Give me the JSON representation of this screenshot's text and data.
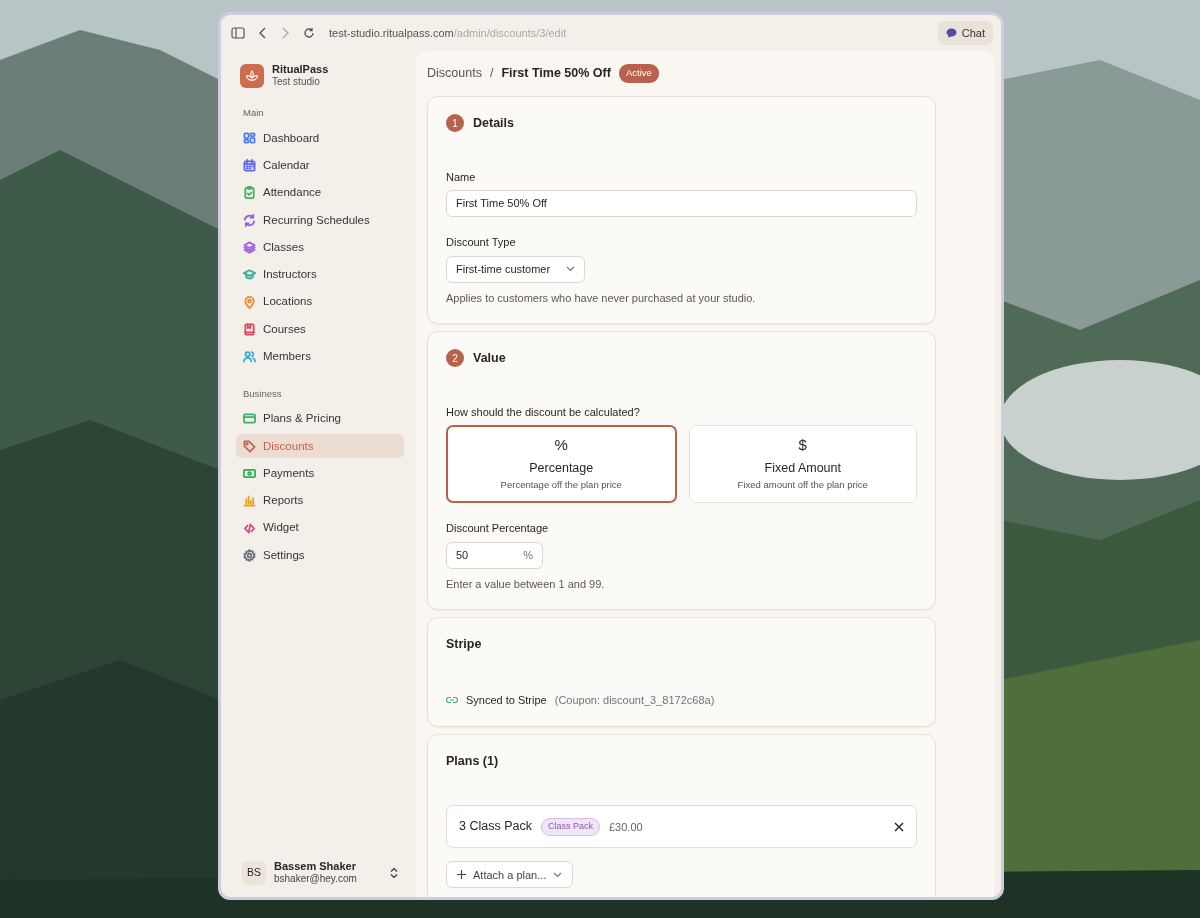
{
  "browser": {
    "url_host": "test-studio.ritualpass.com",
    "url_path": "/admin/discounts/3/edit",
    "chat_button": "Chat"
  },
  "sidebar": {
    "brand": {
      "name": "RitualPass",
      "subtitle": "Test studio"
    },
    "sections": [
      {
        "title": "Main",
        "items": [
          {
            "label": "Dashboard",
            "selected": false,
            "color": "#4f7be8"
          },
          {
            "label": "Calendar",
            "selected": false,
            "color": "#6366f1"
          },
          {
            "label": "Attendance",
            "selected": false,
            "color": "#3fb25a"
          },
          {
            "label": "Recurring Schedules",
            "selected": false,
            "color": "#8b5cf6"
          },
          {
            "label": "Classes",
            "selected": false,
            "color": "#9f5ce6"
          },
          {
            "label": "Instructors",
            "selected": false,
            "color": "#2fae9a"
          },
          {
            "label": "Locations",
            "selected": false,
            "color": "#ee8a2c"
          },
          {
            "label": "Courses",
            "selected": false,
            "color": "#e0445e"
          },
          {
            "label": "Members",
            "selected": false,
            "color": "#38a9d6"
          }
        ]
      },
      {
        "title": "Business",
        "items": [
          {
            "label": "Plans & Pricing",
            "selected": false,
            "color": "#3fae6a"
          },
          {
            "label": "Discounts",
            "selected": true,
            "color": "#c0654f"
          },
          {
            "label": "Payments",
            "selected": false,
            "color": "#2fae5a"
          },
          {
            "label": "Reports",
            "selected": false,
            "color": "#f0a020"
          },
          {
            "label": "Widget",
            "selected": false,
            "color": "#e0407a"
          },
          {
            "label": "Settings",
            "selected": false,
            "color": "#6b7280"
          }
        ]
      }
    ],
    "user": {
      "initials": "BS",
      "name": "Bassem Shaker",
      "email": "bshaker@hey.com"
    }
  },
  "breadcrumb": {
    "parent": "Discounts",
    "separator": "/",
    "current": "First Time 50% Off",
    "status": "Active"
  },
  "details": {
    "step": "1",
    "title": "Details",
    "name_label": "Name",
    "name_value": "First Time 50% Off",
    "type_label": "Discount Type",
    "type_value": "First-time customer",
    "type_help": "Applies to customers who have never purchased at your studio."
  },
  "value": {
    "step": "2",
    "title": "Value",
    "question": "How should the discount be calculated?",
    "options": [
      {
        "symbol": "%",
        "title": "Percentage",
        "description": "Percentage off the plan price",
        "selected": true
      },
      {
        "symbol": "$",
        "title": "Fixed Amount",
        "description": "Fixed amount off the plan price",
        "selected": false
      }
    ],
    "amount_label": "Discount Percentage",
    "amount_value": "50",
    "amount_suffix": "%",
    "amount_help": "Enter a value between 1 and 99."
  },
  "stripe": {
    "title": "Stripe",
    "status": "Synced to Stripe",
    "coupon": "(Coupon: discount_3_8172c68a)"
  },
  "plans": {
    "title": "Plans (1)",
    "items": [
      {
        "name": "3 Class Pack",
        "tag": "Class Pack",
        "price": "£30.00"
      }
    ],
    "attach_button": "Attach a plan..."
  }
}
